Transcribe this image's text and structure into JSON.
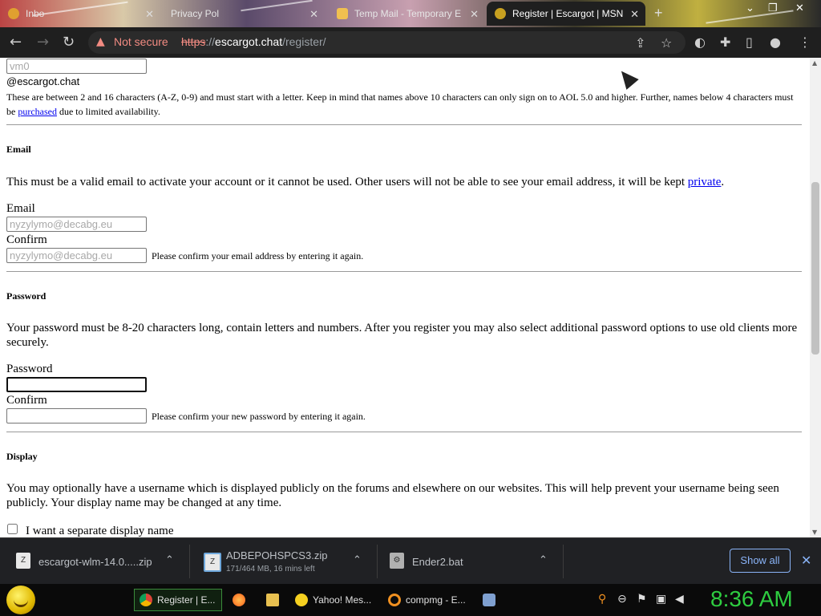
{
  "browser": {
    "tabs": [
      {
        "title": "Inbo",
        "active": false
      },
      {
        "title": "Privacy Pol",
        "active": false
      },
      {
        "title": "Temp Mail - Temporary E",
        "active": false
      },
      {
        "title": "Register | Escargot | MSN",
        "active": true
      }
    ],
    "new_tab": "+",
    "security_label": "Not secure",
    "url_scheme": "https",
    "url_sep": "://",
    "url_host": "escargot.chat",
    "url_path": "/register/"
  },
  "form": {
    "username_value": "vm0",
    "username_suffix": "@escargot.chat",
    "username_help_1": "These are between 2 and 16 characters (A-Z, 0-9) and must start with a letter. Keep in mind that names above 10 characters can only sign on to AOL 5.0 and higher. Further, names below 4 characters must be ",
    "username_help_link": "purchased",
    "username_help_2": " due to limited availability.",
    "email_heading": "Email",
    "email_desc_1": "This must be a valid email to activate your account or it cannot be used. Other users will not be able to see your email address, it will be kept ",
    "email_desc_link": "private",
    "email_desc_2": ".",
    "email_label": "Email",
    "email_value": "nyzylymo@decabg.eu",
    "email_confirm_label": "Confirm",
    "email_confirm_value": "nyzylymo@decabg.eu",
    "email_confirm_hint": "Please confirm your email address by entering it again.",
    "password_heading": "Password",
    "password_desc": "Your password must be 8-20 characters long, contain letters and numbers. After you register you may also select additional password options to use old clients more securely.",
    "password_label": "Password",
    "password_confirm_label": "Confirm",
    "password_confirm_hint": "Please confirm your new password by entering it again.",
    "display_heading": "Display",
    "display_desc": "You may optionally have a username which is displayed publicly on the forums and elsewhere on our websites. This will help prevent your username being seen publicly. Your display name may be changed at any time.",
    "display_checkbox_label": "I want a separate display name"
  },
  "downloads": {
    "items": [
      {
        "name": "escargot-wlm-14.0.....zip",
        "status": ""
      },
      {
        "name": "ADBEPOHSPCS3.zip",
        "status": "171/464 MB, 16 mins left"
      },
      {
        "name": "Ender2.bat",
        "status": ""
      }
    ],
    "show_all": "Show all"
  },
  "taskbar": {
    "tasks": [
      {
        "label": "Register | E...",
        "active": true
      },
      {
        "label": "",
        "active": false
      },
      {
        "label": "",
        "active": false
      },
      {
        "label": "Yahoo! Mes...",
        "active": false
      },
      {
        "label": "compmg - E...",
        "active": false
      }
    ],
    "clock": "8:36 AM"
  },
  "colors": {
    "accent_link": "#0000ee",
    "not_secure": "#f28b82",
    "clock": "#2ecc40",
    "show_all_border": "#8ab4f8"
  }
}
